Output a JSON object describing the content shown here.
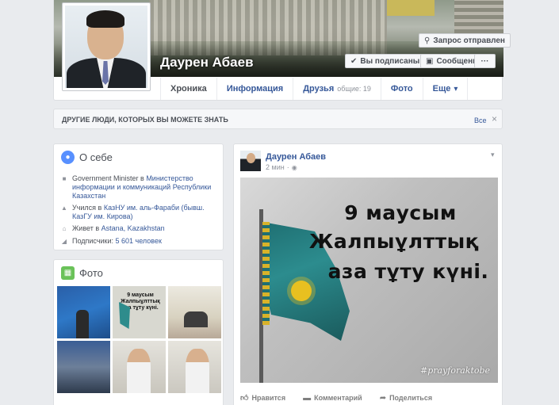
{
  "profile": {
    "name": "Даурен Абаев",
    "buttons": {
      "request_sent": "Запрос отправлен",
      "following": "Вы подписаны",
      "message": "Сообщение",
      "more": "···"
    },
    "tabs": [
      {
        "label": "Хроника"
      },
      {
        "label": "Информация"
      },
      {
        "label": "Друзья",
        "count": "общие: 19"
      },
      {
        "label": "Фото"
      },
      {
        "label": "Еще"
      }
    ]
  },
  "pymk": {
    "title": "ДРУГИЕ ЛЮДИ, КОТОРЫХ ВЫ МОЖЕТЕ ЗНАТЬ",
    "see_all": "Все"
  },
  "about": {
    "title": "О себе",
    "rows": [
      {
        "prefix": "Government Minister в ",
        "link": "Министерство информации и коммуникаций Республики Казахстан"
      },
      {
        "prefix": "Учился в ",
        "link": "КазНУ им. аль-Фараби (бывш. КазГУ им. Кирова)"
      },
      {
        "prefix": "Живет в ",
        "link": "Astana, Kazakhstan"
      },
      {
        "prefix": "Подписчики: ",
        "link": "5 601 человек"
      }
    ]
  },
  "photos": {
    "title": "Фото",
    "thumb2_text": "9 маусым Жалпыұлттық аза тұту күні."
  },
  "post": {
    "author": "Даурен Абаев",
    "time": "2 мин",
    "image_text": [
      "9 маусым",
      "Жалпыұлттық",
      "аза тұту күні."
    ],
    "hashtag": "#prayforaktobe",
    "actions": {
      "like": "Нравится",
      "comment": "Комментарий",
      "share": "Поделиться"
    }
  }
}
